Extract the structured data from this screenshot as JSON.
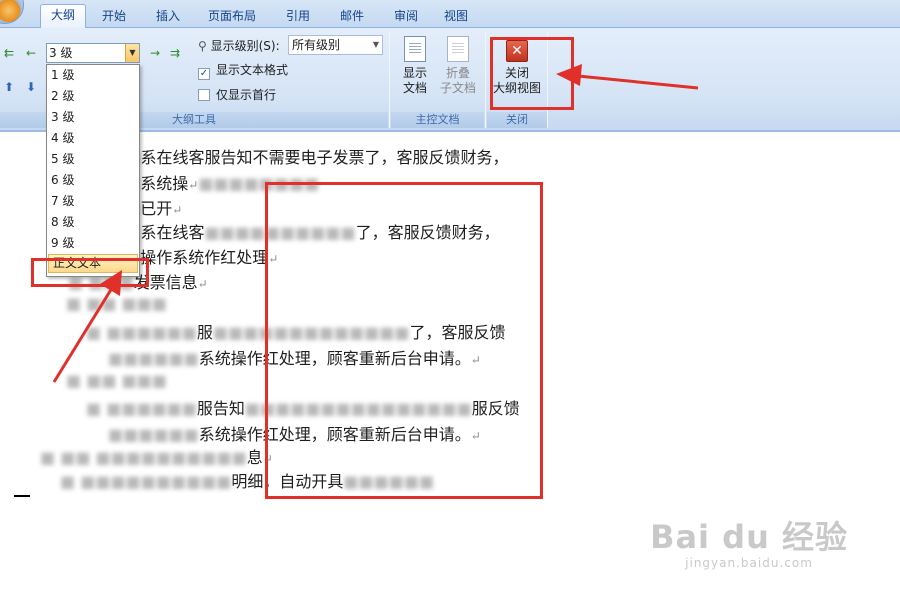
{
  "tabs": [
    "大纲",
    "开始",
    "插入",
    "页面布局",
    "引用",
    "邮件",
    "审阅",
    "视图"
  ],
  "ribbon": {
    "outline_level_combo_value": "3 级",
    "level_options": [
      "1 级",
      "2 级",
      "3 级",
      "4 级",
      "5 级",
      "6 级",
      "7 级",
      "8 级",
      "9 级",
      "正文文本"
    ],
    "show_level_label": "显示级别(S):",
    "show_level_value": "所有级别",
    "show_text_formatting": "显示文本格式",
    "show_first_line_only": "仅显示首行",
    "show_document_label_1": "显示",
    "show_document_label_2": "文档",
    "collapse_subdoc_label_1": "折叠",
    "collapse_subdoc_label_2": "子文档",
    "close_label_1": "关闭",
    "close_label_2": "大纲视图",
    "group_outline_tools": "大纲工具",
    "group_master_document": "主控文档",
    "group_close": "关闭"
  },
  "document_lines": [
    {
      "pre": "系在线客服告知不需要电子发票了，客服反馈财务，",
      "mark": ""
    },
    {
      "pre": "系统操",
      "mark": "↵"
    },
    {
      "pre": "已开",
      "mark": "↵"
    },
    {
      "pre": "系在线客",
      "post": "了，客服反馈财务，",
      "mark": ""
    },
    {
      "pre": "操作系统作红处理",
      "mark": "↵"
    },
    {
      "pre": "发票信息",
      "mark": "↵"
    },
    {
      "pre": "服",
      "post": "了，客服反馈",
      "mark": ""
    },
    {
      "pre": "系统操",
      "post": "作红处理，顾客重新后台申请。",
      "mark": "↵"
    },
    {
      "pre": "服告知",
      "post": "服反馈",
      "mark": ""
    },
    {
      "pre": "系统操",
      "post": "作红处理，顾客重新后台申请。",
      "mark": "↵"
    },
    {
      "pre": "息",
      "mark": "↵"
    },
    {
      "pre": "明细，自动开具",
      "mark": ""
    }
  ],
  "watermark": {
    "main": "Bai du 经验",
    "sub": "jingyan.baidu.com"
  },
  "colors": {
    "annotation_red": "#e0302a",
    "ribbon_blue": "#c6d9f1",
    "tab_text": "#15428b"
  }
}
